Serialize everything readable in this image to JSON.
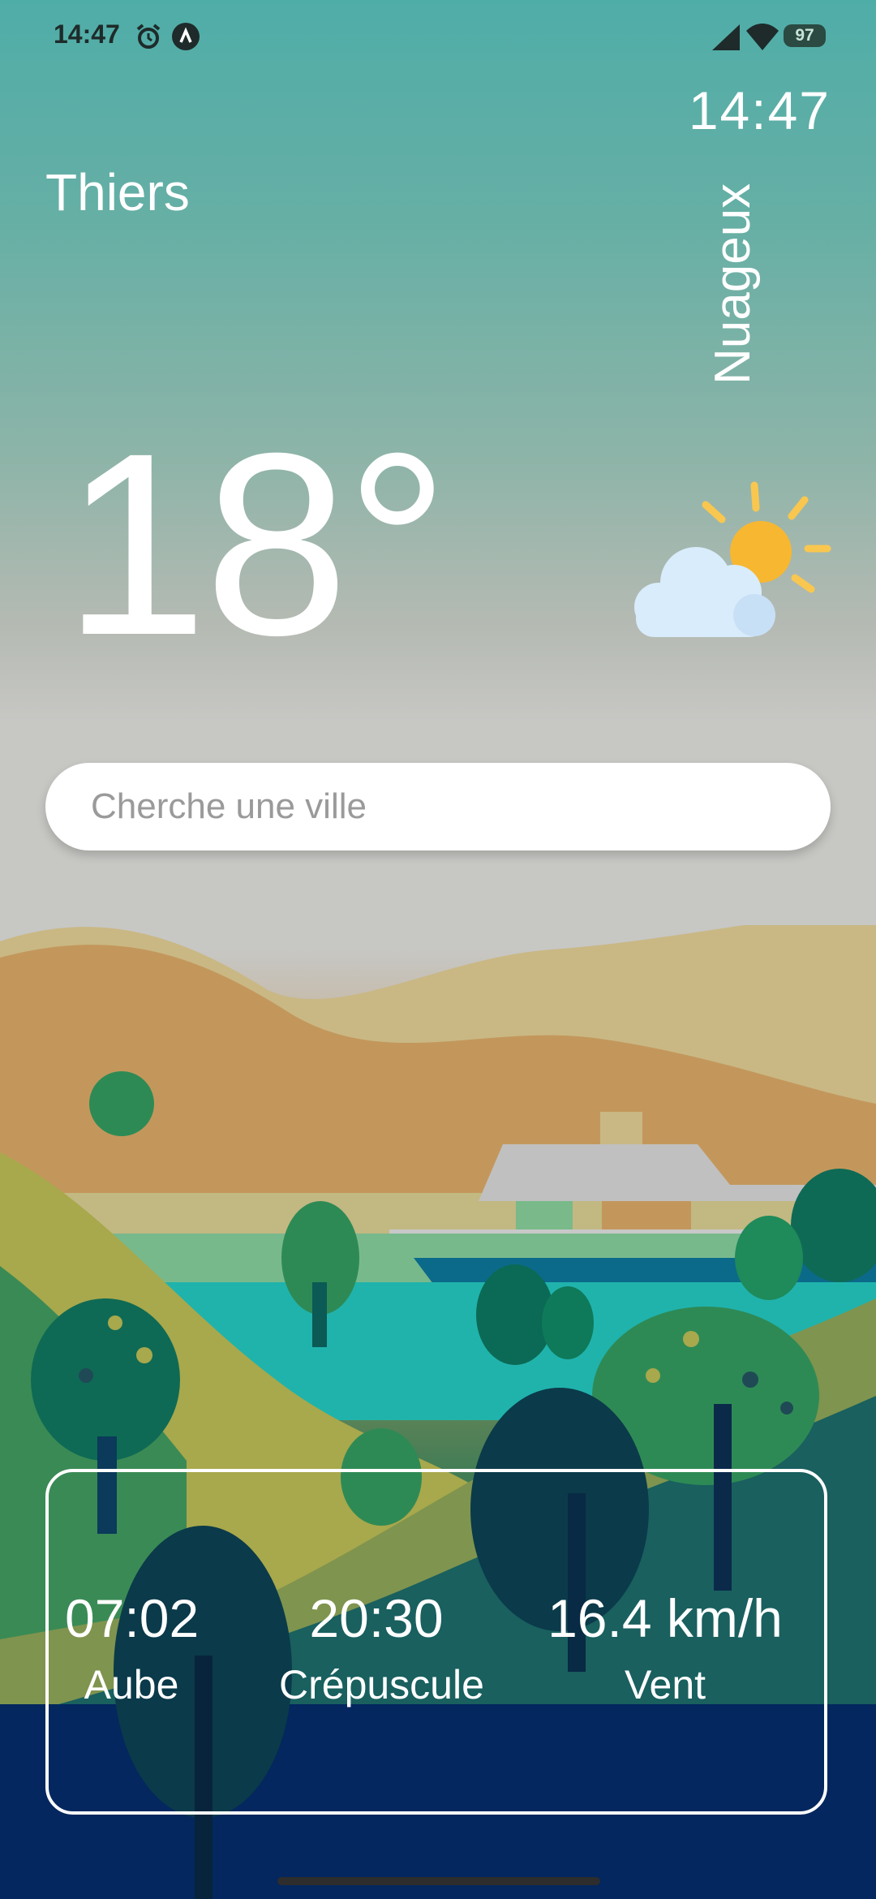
{
  "status_bar": {
    "time": "14:47",
    "battery": "97",
    "icons": [
      "alarm-icon",
      "app-notification-icon",
      "signal-icon",
      "wifi-icon",
      "battery-icon"
    ]
  },
  "header": {
    "clock": "14:47",
    "city": "Thiers",
    "condition": "Nuageux"
  },
  "current": {
    "temperature": "18°",
    "icon": "sun-behind-cloud-icon"
  },
  "search": {
    "placeholder": "Cherche une ville",
    "value": ""
  },
  "stats": [
    {
      "value": "07:02",
      "label": "Aube"
    },
    {
      "value": "20:30",
      "label": "Crépuscule"
    },
    {
      "value": "16.4 km/h",
      "label": "Vent"
    }
  ],
  "colors": {
    "sky_top": "#4fada8",
    "sky_mid": "#c7c7c4",
    "ground_dark": "#02063c",
    "sun": "#f7b731",
    "cloud": "#d9ecfb"
  }
}
